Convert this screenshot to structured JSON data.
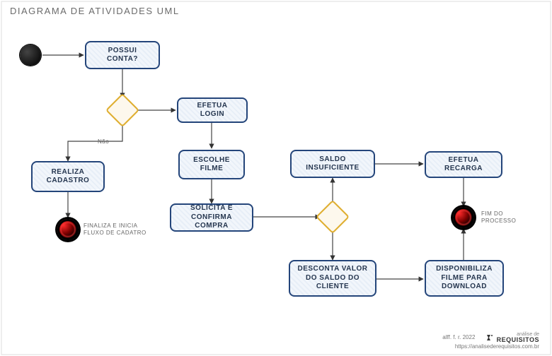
{
  "title": "DIAGRAMA DE ATIVIDADES UML",
  "nodes": {
    "possui_conta": "POSSUI CONTA?",
    "efetua_login": "EFETUA LOGIN",
    "realiza_cadastro": "REALIZA CADASTRO",
    "escolhe_filme": "ESCOLHE FILME",
    "solicita_confirma": "SOLICITA E CONFIRMA COMPRA",
    "saldo_insuficiente": "SALDO INSUFICIENTE",
    "efetua_recarga": "EFETUA RECARGA",
    "desconta_valor": "DESCONTA VALOR DO SALDO DO CLIENTE",
    "disponibiliza": "DISPONIBILIZA FILME PARA DOWNLOAD"
  },
  "labels": {
    "nao": "Não",
    "fim_fluxo_cadastro": "FINALIZA E INICIA FLUXO DE CADATRO",
    "fim_processo": "FIM DO PROCESSO"
  },
  "footer": {
    "credit": "alff. f. r. 2022",
    "url": "https://analisederequisitos.com.br",
    "brand_sub": "análise de",
    "brand_main": "REQUISITOS"
  }
}
